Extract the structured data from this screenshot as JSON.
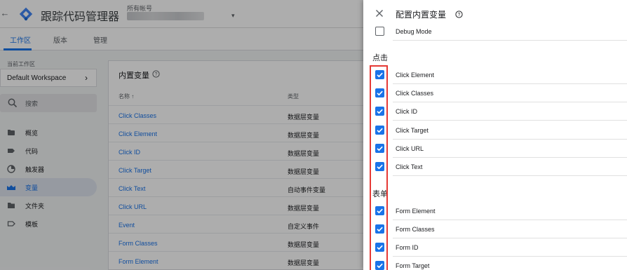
{
  "topbar": {
    "back_glyph": "←",
    "app_title": "跟踪代码管理器",
    "account_label": "所有帐号",
    "account_caret": "▾"
  },
  "tabs": [
    {
      "label": "工作区",
      "active": true
    },
    {
      "label": "版本",
      "active": false
    },
    {
      "label": "管理",
      "active": false
    }
  ],
  "sidebar": {
    "workspace_label": "当前工作区",
    "workspace_name": "Default Workspace",
    "workspace_arrow": "›",
    "search_placeholder": "搜索",
    "items": [
      {
        "label": "概览",
        "icon": "overview-icon",
        "active": false
      },
      {
        "label": "代码",
        "icon": "tag-icon",
        "active": false
      },
      {
        "label": "触发器",
        "icon": "trigger-icon",
        "active": false
      },
      {
        "label": "变量",
        "icon": "variables-icon",
        "active": true
      },
      {
        "label": "文件夹",
        "icon": "folder-icon",
        "active": false
      },
      {
        "label": "模板",
        "icon": "template-icon",
        "active": false
      }
    ]
  },
  "main": {
    "card_title": "内置变量",
    "col_name": "名称 ↑",
    "col_type": "类型",
    "rows": [
      {
        "name": "Click Classes",
        "type": "数据层变量"
      },
      {
        "name": "Click Element",
        "type": "数据层变量"
      },
      {
        "name": "Click ID",
        "type": "数据层变量"
      },
      {
        "name": "Click Target",
        "type": "数据层变量"
      },
      {
        "name": "Click Text",
        "type": "自动事件变量"
      },
      {
        "name": "Click URL",
        "type": "数据层变量"
      },
      {
        "name": "Event",
        "type": "自定义事件"
      },
      {
        "name": "Form Classes",
        "type": "数据层变量"
      },
      {
        "name": "Form Element",
        "type": "数据层变量"
      }
    ]
  },
  "panel": {
    "title": "配置内置变量",
    "close_glyph": "×",
    "top_item": {
      "label": "Debug Mode",
      "checked": false
    },
    "sections": [
      {
        "label": "点击",
        "items": [
          {
            "label": "Click Element",
            "checked": true
          },
          {
            "label": "Click Classes",
            "checked": true
          },
          {
            "label": "Click ID",
            "checked": true
          },
          {
            "label": "Click Target",
            "checked": true
          },
          {
            "label": "Click URL",
            "checked": true
          },
          {
            "label": "Click Text",
            "checked": true
          }
        ]
      },
      {
        "label": "表单",
        "items": [
          {
            "label": "Form Element",
            "checked": true
          },
          {
            "label": "Form Classes",
            "checked": true
          },
          {
            "label": "Form ID",
            "checked": true
          },
          {
            "label": "Form Target",
            "checked": true
          }
        ]
      }
    ]
  },
  "colors": {
    "accent": "#1a73e8",
    "highlight_box": "#e53935",
    "scrim": "rgba(0,0,0,0.32)"
  }
}
